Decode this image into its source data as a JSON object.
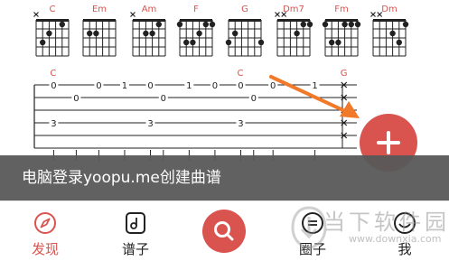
{
  "chords": [
    {
      "name": "C",
      "dots": [
        [
          2,
          1
        ],
        [
          4,
          2
        ],
        [
          5,
          3
        ]
      ],
      "open": [
        3
      ],
      "muted": [
        6
      ]
    },
    {
      "name": "Em",
      "dots": [
        [
          4,
          2
        ],
        [
          5,
          2
        ]
      ],
      "open": [
        1,
        2,
        3,
        6
      ],
      "muted": []
    },
    {
      "name": "Am",
      "dots": [
        [
          2,
          1
        ],
        [
          3,
          2
        ],
        [
          4,
          2
        ]
      ],
      "open": [
        1,
        5
      ],
      "muted": [
        6
      ]
    },
    {
      "name": "F",
      "dots": [
        [
          1,
          1
        ],
        [
          2,
          1
        ],
        [
          3,
          2
        ],
        [
          4,
          3
        ],
        [
          5,
          3
        ],
        [
          6,
          1
        ]
      ],
      "open": [],
      "muted": []
    },
    {
      "name": "G",
      "dots": [
        [
          1,
          3
        ],
        [
          5,
          2
        ],
        [
          6,
          3
        ]
      ],
      "open": [
        2,
        3,
        4
      ],
      "muted": []
    },
    {
      "name": "Dm7",
      "dots": [
        [
          1,
          1
        ],
        [
          2,
          1
        ],
        [
          3,
          2
        ]
      ],
      "open": [
        4
      ],
      "muted": [
        5,
        6
      ]
    },
    {
      "name": "Fm",
      "dots": [
        [
          1,
          1
        ],
        [
          2,
          1
        ],
        [
          3,
          1
        ],
        [
          4,
          3
        ],
        [
          5,
          3
        ],
        [
          6,
          1
        ]
      ],
      "open": [],
      "muted": []
    },
    {
      "name": "Dm",
      "dots": [
        [
          1,
          1
        ],
        [
          3,
          2
        ],
        [
          2,
          3
        ]
      ],
      "open": [
        4
      ],
      "muted": [
        5,
        6
      ]
    }
  ],
  "tab": {
    "chord_labels": [
      {
        "label": "C",
        "pos": 0.06
      },
      {
        "label": "C",
        "pos": 0.64
      },
      {
        "label": "G",
        "pos": 0.96
      }
    ],
    "notes": [
      {
        "string": 1,
        "pos": 0.06,
        "fret": "0"
      },
      {
        "string": 1,
        "pos": 0.2,
        "fret": "0"
      },
      {
        "string": 1,
        "pos": 0.28,
        "fret": "1"
      },
      {
        "string": 1,
        "pos": 0.36,
        "fret": "0"
      },
      {
        "string": 1,
        "pos": 0.48,
        "fret": "1"
      },
      {
        "string": 1,
        "pos": 0.56,
        "fret": "0"
      },
      {
        "string": 1,
        "pos": 0.64,
        "fret": "0"
      },
      {
        "string": 1,
        "pos": 0.74,
        "fret": "0"
      },
      {
        "string": 1,
        "pos": 0.87,
        "fret": "1"
      },
      {
        "string": 2,
        "pos": 0.13,
        "fret": "0"
      },
      {
        "string": 2,
        "pos": 0.4,
        "fret": "0"
      },
      {
        "string": 2,
        "pos": 0.68,
        "fret": "0"
      },
      {
        "string": 4,
        "pos": 0.06,
        "fret": "3"
      },
      {
        "string": 4,
        "pos": 0.36,
        "fret": "3"
      },
      {
        "string": 4,
        "pos": 0.64,
        "fret": "3"
      }
    ],
    "x_strings": [
      1,
      2,
      3,
      4,
      5
    ]
  },
  "toast": {
    "text": "电脑登录yoopu.me创建曲谱"
  },
  "nav": {
    "items": [
      {
        "label": "发现",
        "icon": "compass-icon"
      },
      {
        "label": "谱子",
        "icon": "music-note-icon"
      },
      {
        "label": "",
        "icon": "search-icon"
      },
      {
        "label": "圈子",
        "icon": "chat-bubble-icon"
      },
      {
        "label": "我",
        "icon": "face-icon"
      }
    ]
  },
  "watermark": {
    "title": "当下软件园",
    "url": "www.downxia.com"
  },
  "colors": {
    "accent": "#d9534f",
    "arrow": "#f07a2a",
    "toast_bg": "#585858"
  }
}
